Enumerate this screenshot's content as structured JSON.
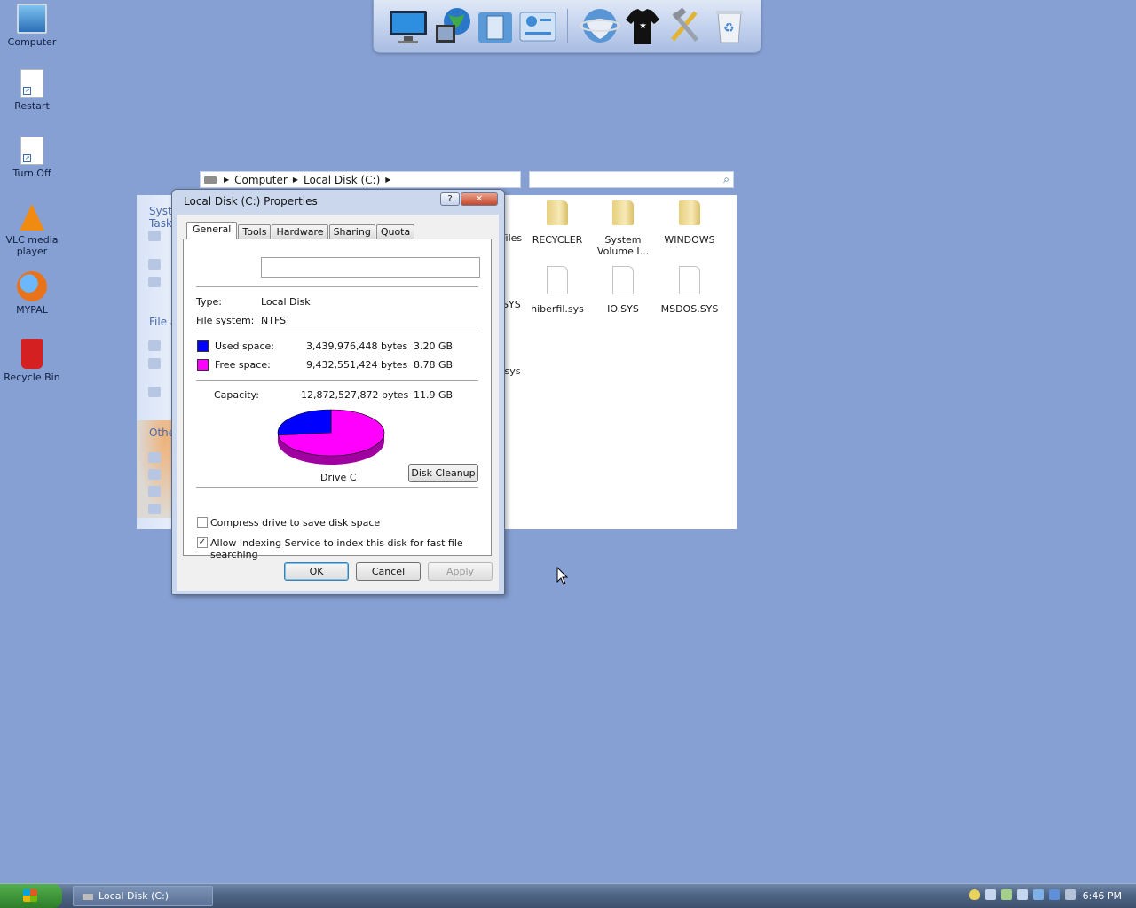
{
  "desktop": {
    "icons": [
      {
        "label": "Computer"
      },
      {
        "label": "Restart"
      },
      {
        "label": "Turn Off"
      },
      {
        "label": "VLC media player"
      },
      {
        "label": "MYPAL"
      },
      {
        "label": "Recycle Bin"
      }
    ]
  },
  "explorer": {
    "breadcrumb": [
      "Computer",
      "Local Disk (C:)"
    ],
    "sidebar": {
      "system_tasks": "System Tasks",
      "file_and": "File a",
      "other": "Other"
    },
    "files": [
      {
        "name": "RECYCLER",
        "kind": "folder"
      },
      {
        "name": "System Volume I...",
        "kind": "folder"
      },
      {
        "name": "WINDOWS",
        "kind": "folder"
      },
      {
        "name": "hiberfil.sys",
        "kind": "file"
      },
      {
        "name": "IO.SYS",
        "kind": "file"
      },
      {
        "name": "MSDOS.SYS",
        "kind": "file"
      }
    ],
    "partial_labels": [
      "Files",
      "SYS",
      ".sys"
    ]
  },
  "dialog": {
    "title": "Local Disk (C:) Properties",
    "help_glyph": "?",
    "close_glyph": "✕",
    "tabs": [
      "General",
      "Tools",
      "Hardware",
      "Sharing",
      "Quota"
    ],
    "active_tab": "General",
    "volume_name": "",
    "type_label": "Type:",
    "type_value": "Local Disk",
    "fs_label": "File system:",
    "fs_value": "NTFS",
    "used_label": "Used space:",
    "used_bytes": "3,439,976,448 bytes",
    "used_gb": "3.20 GB",
    "free_label": "Free space:",
    "free_bytes": "9,432,551,424 bytes",
    "free_gb": "8.78 GB",
    "capacity_label": "Capacity:",
    "capacity_bytes": "12,872,527,872 bytes",
    "capacity_gb": "11.9 GB",
    "drive_label": "Drive C",
    "disk_cleanup": "Disk Cleanup",
    "compress_label": "Compress drive to save disk space",
    "compress_checked": false,
    "index_label": "Allow Indexing Service to index this disk for fast file searching",
    "index_checked": true,
    "ok": "OK",
    "cancel": "Cancel",
    "apply": "Apply",
    "used_fraction": 0.2672,
    "used_color": "#0000ff",
    "free_color": "#ff00ff"
  },
  "taskbar": {
    "task_label": "Local Disk (C:)",
    "clock": "6:46 PM"
  },
  "dock": {
    "items": [
      "monitor-icon",
      "globe-icon",
      "document-icon",
      "settings-panel-icon",
      "network-globe-icon",
      "tshirt-icon",
      "tools-icon",
      "recycle-icon"
    ]
  }
}
